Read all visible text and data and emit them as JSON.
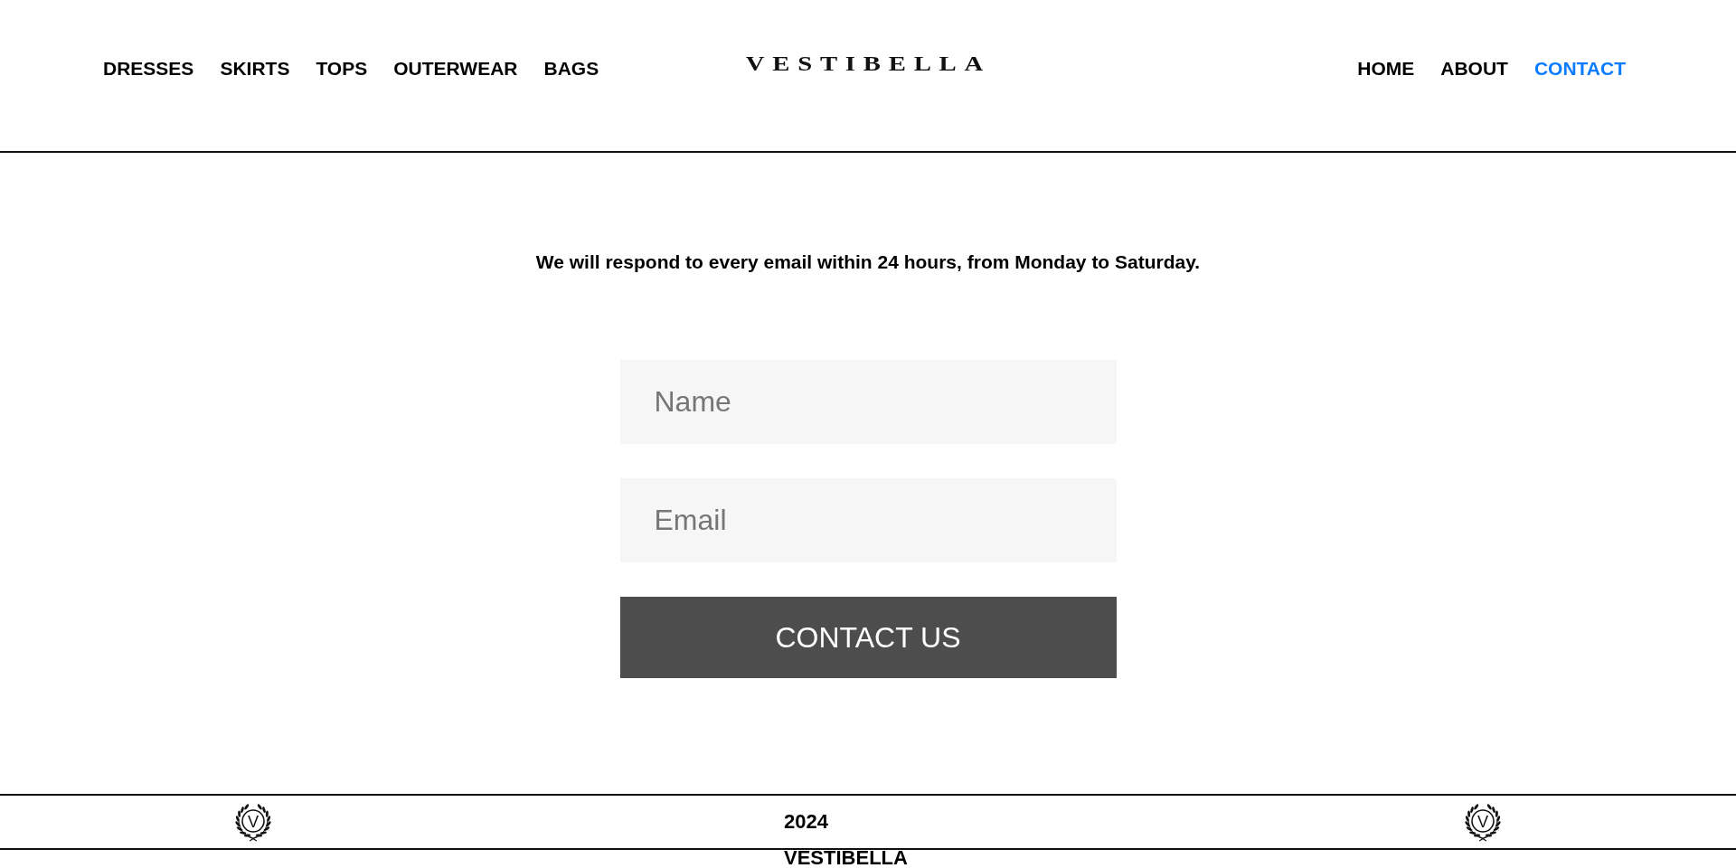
{
  "header": {
    "nav_left": [
      {
        "label": "DRESSES",
        "selected": false
      },
      {
        "label": "SKIRTS",
        "selected": false
      },
      {
        "label": "TOPS",
        "selected": false
      },
      {
        "label": "OUTERWEAR",
        "selected": false
      },
      {
        "label": "BAGS",
        "selected": false
      }
    ],
    "logo": "VESTIBELLA",
    "nav_right": [
      {
        "label": "HOME",
        "selected": false
      },
      {
        "label": "ABOUT",
        "selected": false
      },
      {
        "label": "CONTACT",
        "selected": true
      }
    ]
  },
  "contact": {
    "intro": "We will respond to every email within 24 hours, from Monday to Saturday.",
    "fields": [
      {
        "placeholder": "Name"
      },
      {
        "placeholder": "Email"
      }
    ],
    "submit": "CONTACT US"
  },
  "footer": {
    "emblems": [
      {
        "letter": "V"
      },
      {
        "letter": "V"
      }
    ],
    "year": "2024",
    "brand": "VESTIBELLA"
  }
}
